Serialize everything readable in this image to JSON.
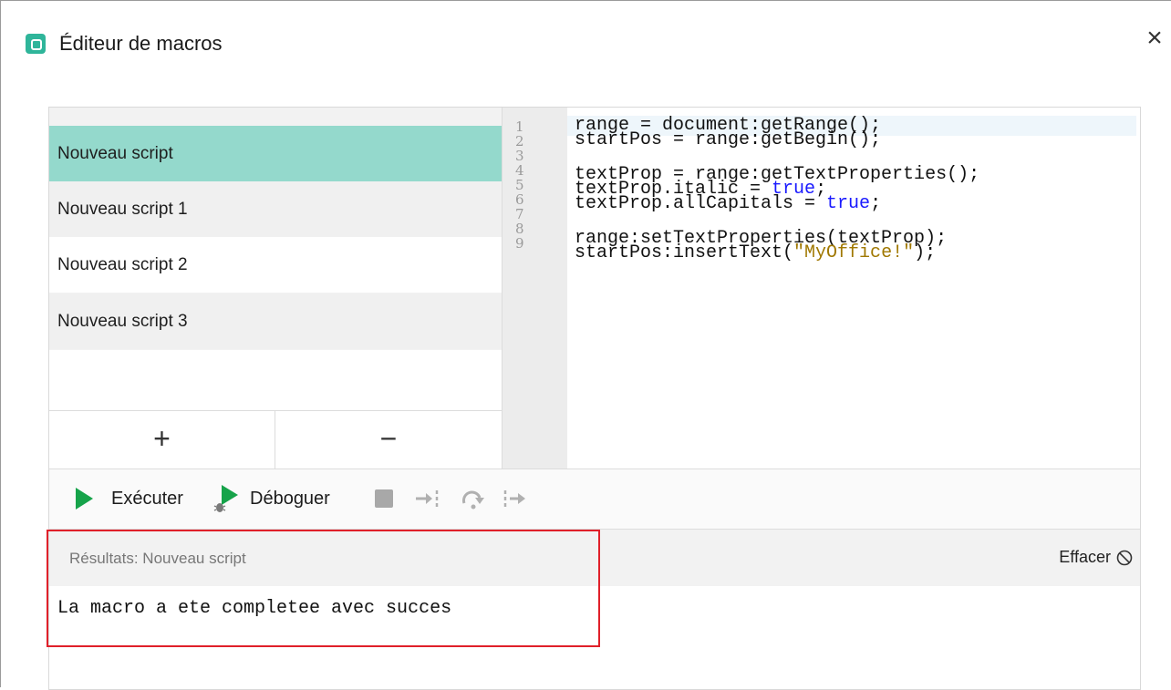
{
  "window": {
    "title": "Éditeur de macros",
    "close_glyph": "×"
  },
  "scripts": {
    "items": [
      {
        "label": "Nouveau script",
        "selected": true
      },
      {
        "label": "Nouveau script 1",
        "selected": false
      },
      {
        "label": "Nouveau script 2",
        "selected": false
      },
      {
        "label": "Nouveau script 3",
        "selected": false
      }
    ],
    "add_glyph": "+",
    "remove_glyph": "−"
  },
  "editor": {
    "line_numbers": [
      "1",
      "2",
      "3",
      "4",
      "5",
      "6",
      "7",
      "8",
      "9"
    ],
    "lines": [
      [
        {
          "t": "range = document:getRange();"
        }
      ],
      [
        {
          "t": "startPos = range:getBegin();"
        }
      ],
      [],
      [
        {
          "t": "textProp = range:getTextProperties();"
        }
      ],
      [
        {
          "t": "textProp.italic = "
        },
        {
          "t": "true",
          "k": "kw"
        },
        {
          "t": ";"
        }
      ],
      [
        {
          "t": "textProp.allCapitals = "
        },
        {
          "t": "true",
          "k": "kw"
        },
        {
          "t": ";"
        }
      ],
      [],
      [
        {
          "t": "range:setTextProperties(textProp);"
        }
      ],
      [
        {
          "t": "startPos:insertText("
        },
        {
          "t": "\"MyOffice!\"",
          "k": "str"
        },
        {
          "t": ");"
        }
      ]
    ]
  },
  "toolbar": {
    "run_label": "Exécuter",
    "debug_label": "Déboguer"
  },
  "results": {
    "title": "Résultats: Nouveau script",
    "clear_label": "Effacer",
    "output": "La macro a ete completee avec succes"
  },
  "colors": {
    "accent": "#2fb59a",
    "selected_row": "#94d9cc",
    "highlight_box": "#e0202a",
    "keyword": "#1a1aff",
    "string": "#a07800"
  }
}
